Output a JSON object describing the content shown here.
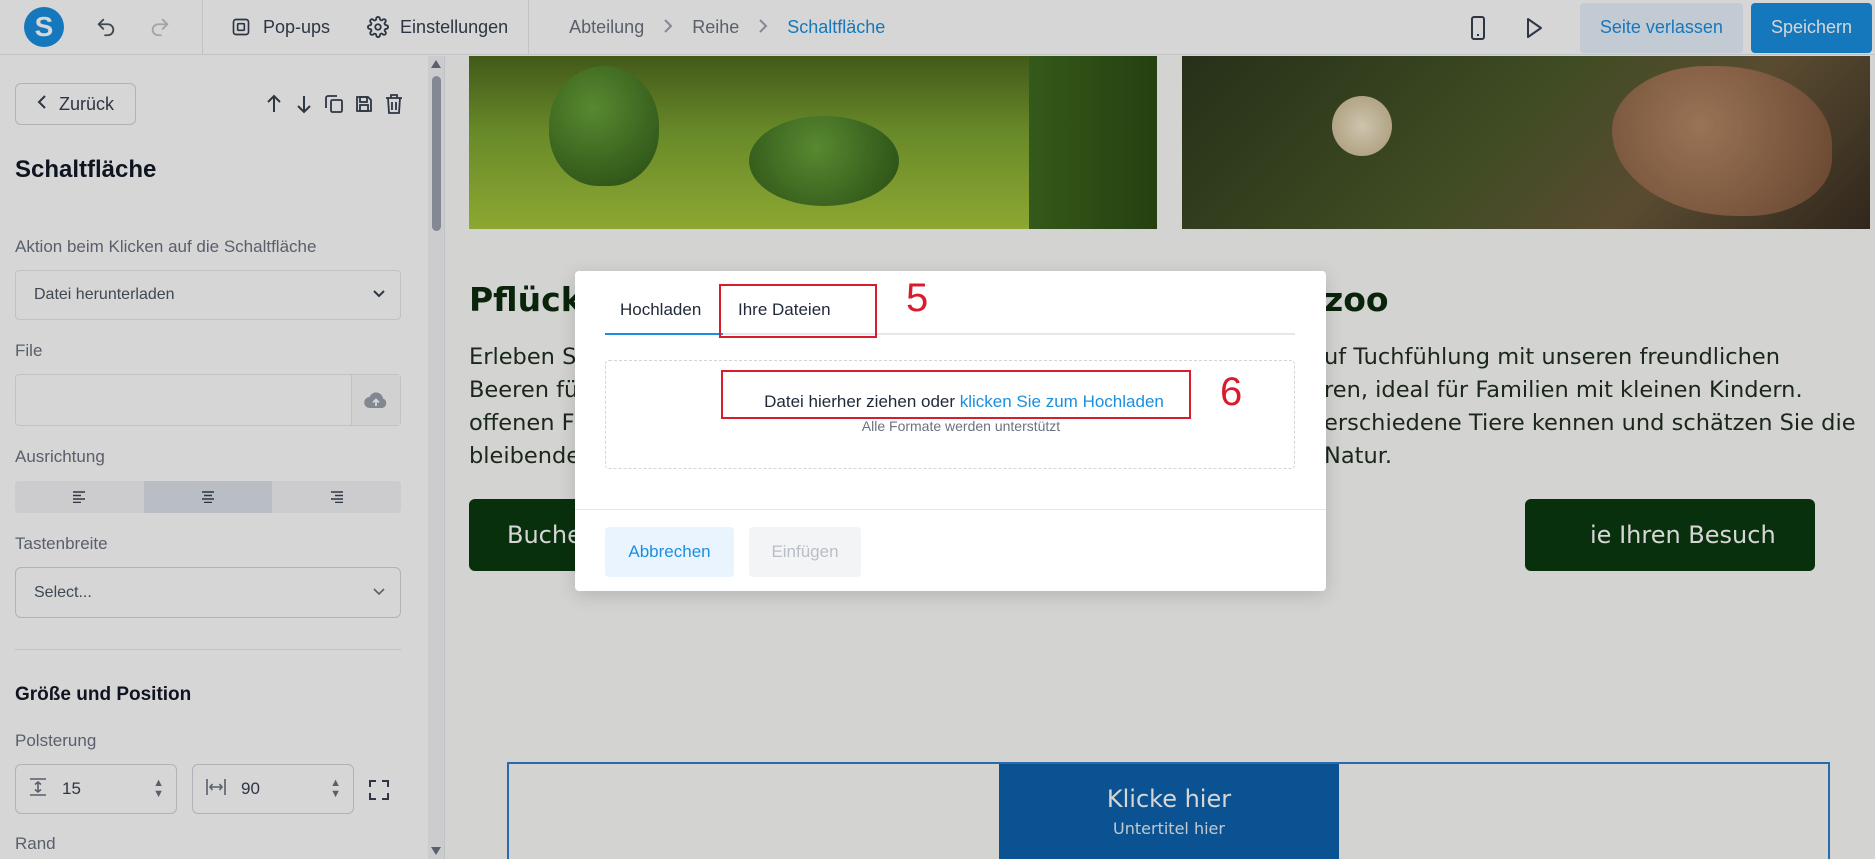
{
  "topbar": {
    "logo_letter": "S",
    "popups_label": "Pop-ups",
    "settings_label": "Einstellungen",
    "breadcrumb": [
      "Abteilung",
      "Reihe",
      "Schaltfläche"
    ],
    "leave_label": "Seite verlassen",
    "save_label": "Speichern",
    "accent_color": "#1a8fe0"
  },
  "panel": {
    "back_label": "Zurück",
    "title": "Schaltfläche",
    "action_label": "Aktion beim Klicken auf die Schaltfläche",
    "action_value": "Datei herunterladen",
    "file_label": "File",
    "file_value": "",
    "alignment_label": "Ausrichtung",
    "alignment_selected": "center",
    "button_width_label": "Tastenbreite",
    "button_width_placeholder": "Select...",
    "size_section_title": "Größe und Position",
    "padding_label": "Polsterung",
    "padding_vertical": "15",
    "padding_horizontal": "90",
    "border_label": "Rand"
  },
  "canvas": {
    "headline_left": "Pflücke",
    "headline_right": "zoo",
    "para_left": [
      "Erleben S",
      "Beeren fü",
      "offenen F",
      "bleibende"
    ],
    "para_right": [
      "uf Tuchfühlung mit unseren freundlichen",
      "ren, ideal für Familien mit kleinen Kindern.",
      "erschiedene Tiere kennen und schätzen Sie die",
      "Natur."
    ],
    "cta_left": "Buche",
    "cta_right": "ie Ihren Besuch",
    "button_title": "Klicke hier",
    "button_subtitle": "Untertitel hier",
    "dark_green": "#0b3a0f",
    "button_blue": "#0d62ad"
  },
  "modal": {
    "tab_upload": "Hochladen",
    "tab_files": "Ihre Dateien",
    "drop_text": "Datei hierher ziehen oder ",
    "drop_link": "klicken Sie zum Hochladen",
    "drop_sub": "Alle Formate werden unterstützt",
    "cancel_label": "Abbrechen",
    "insert_label": "Einfügen",
    "marker_5": "5",
    "marker_6": "6",
    "marker_color": "#d91c2b"
  }
}
